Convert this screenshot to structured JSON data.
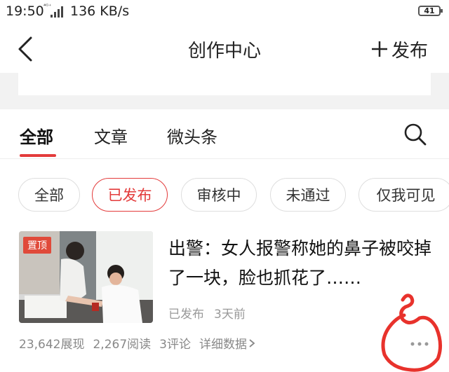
{
  "status_bar": {
    "time": "19:50",
    "network": "⁴ᴳ⁺",
    "speed": "136 KB/s",
    "battery": "41"
  },
  "header": {
    "title": "创作中心",
    "publish_label": "发布"
  },
  "tabs": [
    {
      "label": "全部",
      "active": true
    },
    {
      "label": "文章",
      "active": false
    },
    {
      "label": "微头条",
      "active": false
    }
  ],
  "filters": [
    {
      "label": "全部",
      "active": false
    },
    {
      "label": "已发布",
      "active": true
    },
    {
      "label": "审核中",
      "active": false
    },
    {
      "label": "未通过",
      "active": false
    },
    {
      "label": "仅我可见",
      "active": false
    }
  ],
  "article": {
    "badge": "置顶",
    "title": "出警：女人报警称她的鼻子被咬掉了一块，脸也抓花了……",
    "status": "已发布",
    "time_ago": "3天前",
    "stats": {
      "impressions": "23,642展现",
      "reads": "2,267阅读",
      "comments": "3评论",
      "detail_label": "详细数据"
    }
  },
  "colors": {
    "accent": "#e33b3b",
    "badge": "#e04a3a",
    "annotation": "#e8322c"
  },
  "icons": {
    "back": "chevron-left-icon",
    "add": "plus-icon",
    "search": "search-icon",
    "more": "more-dots-icon"
  }
}
